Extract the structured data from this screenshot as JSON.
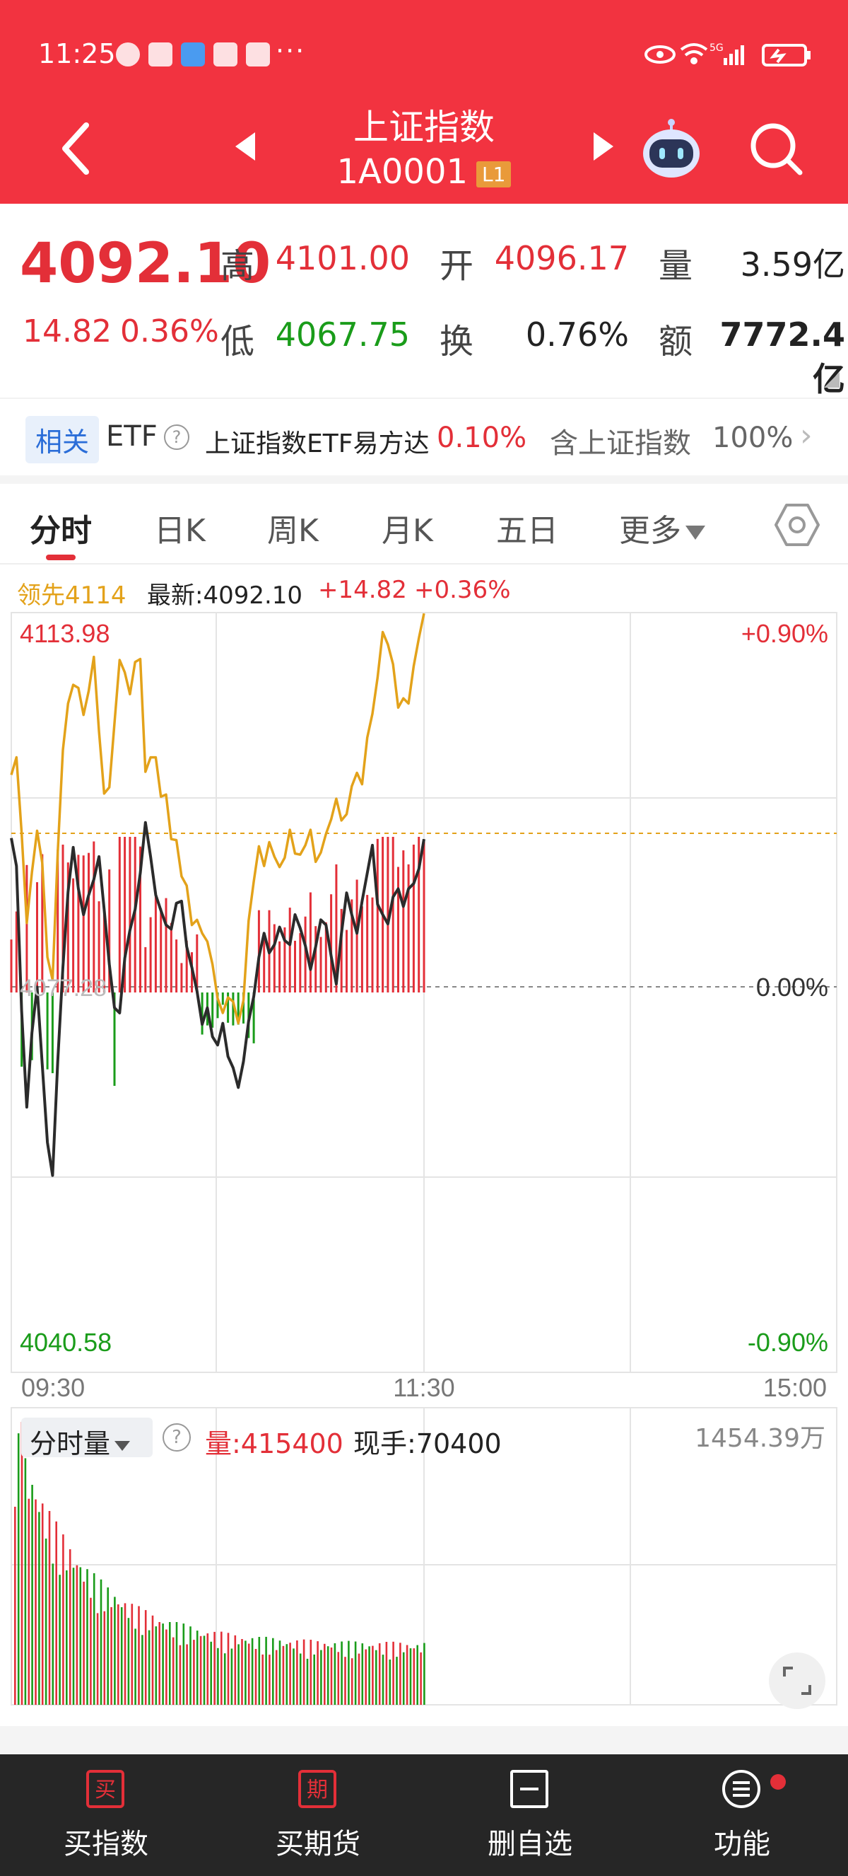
{
  "status_bar": {
    "time": "11:25",
    "more": "···",
    "network": "5G"
  },
  "header": {
    "title": "上证指数",
    "code": "1A0001",
    "level_badge": "L1"
  },
  "quote": {
    "price": "4092.10",
    "change": "14.82",
    "change_pct": "0.36%",
    "high_label": "高",
    "high": "4101.00",
    "open_label": "开",
    "open": "4096.17",
    "volume_label": "量",
    "volume": "3.59亿",
    "low_label": "低",
    "low": "4067.75",
    "turnover_label": "换",
    "turnover": "0.76%",
    "amount_label": "额",
    "amount": "7772.4亿"
  },
  "etf_row": {
    "related_tag": "相关",
    "etf_label": "ETF",
    "help": "?",
    "etf_name": "上证指数ETF易方达",
    "etf_change": "0.10%",
    "contains_label": "含上证指数",
    "contains_value": "100%",
    "chevron": "›"
  },
  "tabs": [
    {
      "label": "分时",
      "active": true
    },
    {
      "label": "日K"
    },
    {
      "label": "周K"
    },
    {
      "label": "月K"
    },
    {
      "label": "五日"
    },
    {
      "label": "更多"
    }
  ],
  "chart_info": {
    "leader": "领先4114",
    "latest": "最新:4092.10",
    "latest_change": "+14.82",
    "latest_pct": "+0.36%"
  },
  "chart_labels": {
    "y_top": "4113.98",
    "y_bottom": "4040.58",
    "y_mid": "4077.28",
    "pct_top": "+0.90%",
    "pct_mid": "0.00%",
    "pct_bottom": "-0.90%",
    "x_labels": [
      "09:30",
      "11:30",
      "15:00"
    ]
  },
  "volume_panel": {
    "mode": "分时量",
    "help": "?",
    "volume": "量:415400",
    "current_hand": "现手:70400",
    "max": "1454.39万"
  },
  "bottom_nav": [
    {
      "label": "买指数",
      "icon_text": "买"
    },
    {
      "label": "买期货",
      "icon_text": "期"
    },
    {
      "label": "删自选"
    },
    {
      "label": "功能"
    }
  ],
  "colors": {
    "up": "#e32f38",
    "down": "#1a9c1a",
    "header": "#f23340",
    "leader_line": "#e3a21a",
    "price_line": "#2b2b2b"
  },
  "chart_data": {
    "type": "line",
    "x_labels": [
      "09:30",
      "11:30",
      "15:00"
    ],
    "ylim": [
      4040.58,
      4113.98
    ],
    "prev_close": 4077.28,
    "series": [
      {
        "name": "最新",
        "values": [
          4092.2,
          4089.5,
          4075.5,
          4066.2,
          4073.4,
          4077.8,
          4070.3,
          4062.8,
          4059.6,
          4070.6,
          4079.7,
          4087.0,
          4091.3,
          4087.3,
          4084.8,
          4086.7,
          4088.2,
          4090.4,
          4085.3,
          4080.0,
          4075.8,
          4075.3,
          4080.6,
          4083.3,
          4085.3,
          4088.8,
          4093.7,
          4090.4,
          4086.7,
          4085.2,
          4083.8,
          4083.4,
          4085.9,
          4086.1,
          4081.7,
          4079.7,
          4077.4,
          4074.2,
          4075.8,
          4073.0,
          4072.2,
          4074.3,
          4071.1,
          4070.0,
          4068.1,
          4070.6,
          4074.5,
          4076.9,
          4080.7,
          4083.0,
          4081.1,
          4081.9,
          4083.6,
          4082.3,
          4081.9,
          4084.8,
          4083.5,
          4081.8,
          4079.5,
          4081.7,
          4084.3,
          4083.8,
          4080.8,
          4078.1,
          4083.0,
          4086.9,
          4084.8,
          4083.0,
          4086.1,
          4088.8,
          4091.5,
          4085.8,
          4084.8,
          4083.9,
          4086.5,
          4087.3,
          4085.6,
          4087.3,
          4087.8,
          4089.2,
          4092.1
        ]
      },
      {
        "name": "领先4114",
        "values": [
          4098.3,
          4100.0,
          4092.7,
          4084.0,
          4088.9,
          4092.9,
          4089.8,
          4080.7,
          4078.5,
          4090.8,
          4100.7,
          4105.2,
          4107.0,
          4106.7,
          4104.1,
          4106.4,
          4109.7,
          4102.5,
          4096.5,
          4097.1,
          4103.3,
          4109.4,
          4108.2,
          4106.1,
          4109.2,
          4109.5,
          4098.6,
          4100.0,
          4100.0,
          4096.2,
          4096.4,
          4092.1,
          4092.0,
          4088.5,
          4087.6,
          4083.8,
          4084.3,
          4083.0,
          4082.2,
          4080.0,
          4076.7,
          4075.3,
          4076.8,
          4076.4,
          4074.3,
          4076.5,
          4084.2,
          4088.0,
          4091.4,
          4089.5,
          4091.8,
          4090.4,
          4089.4,
          4090.3,
          4093.0,
          4090.7,
          4090.6,
          4091.5,
          4093.0,
          4089.9,
          4090.8,
          4092.6,
          4094.0,
          4096.0,
          4093.9,
          4094.5,
          4097.2,
          4098.5,
          4097.4,
          4101.9,
          4104.2,
          4107.7,
          4112.1,
          4110.9,
          4109.0,
          4104.8,
          4105.7,
          4105.2,
          4108.8,
          4111.5,
          4113.9
        ]
      }
    ]
  }
}
